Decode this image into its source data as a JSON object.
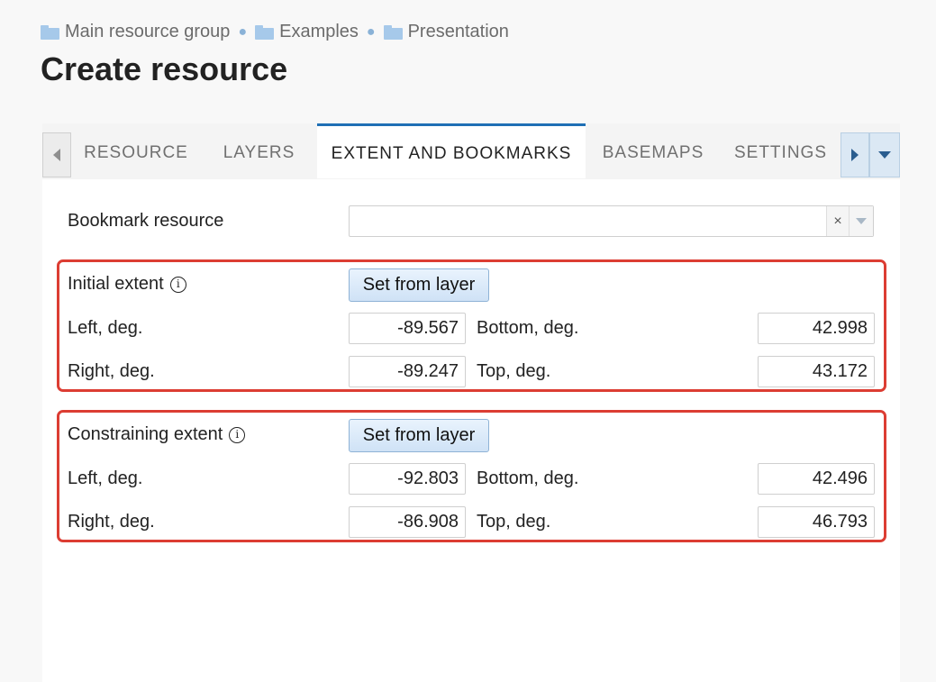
{
  "breadcrumb": [
    {
      "label": "Main resource group"
    },
    {
      "label": "Examples"
    },
    {
      "label": "Presentation"
    }
  ],
  "page_title": "Create resource",
  "tabs": [
    {
      "label": "RESOURCE",
      "active": false
    },
    {
      "label": "LAYERS",
      "active": false
    },
    {
      "label": "EXTENT AND BOOKMARKS",
      "active": true
    },
    {
      "label": "BASEMAPS",
      "active": false
    },
    {
      "label": "SETTINGS",
      "active": false
    }
  ],
  "bookmark": {
    "label": "Bookmark resource",
    "value": "",
    "clear_glyph": "×"
  },
  "initial_extent": {
    "label": "Initial extent",
    "info_glyph": "i",
    "button": "Set from layer",
    "left_label": "Left, deg.",
    "left": "-89.567",
    "bottom_label": "Bottom, deg.",
    "bottom": "42.998",
    "right_label": "Right, deg.",
    "right": "-89.247",
    "top_label": "Top, deg.",
    "top": "43.172"
  },
  "constraining_extent": {
    "label": "Constraining extent",
    "info_glyph": "i",
    "button": "Set from layer",
    "left_label": "Left, deg.",
    "left": "-92.803",
    "bottom_label": "Bottom, deg.",
    "bottom": "42.496",
    "right_label": "Right, deg.",
    "right": "-86.908",
    "top_label": "Top, deg.",
    "top": "46.793"
  },
  "colors": {
    "accent": "#1f6fb5",
    "highlight_border": "#dc3d33",
    "folder": "#a6c9ea"
  }
}
